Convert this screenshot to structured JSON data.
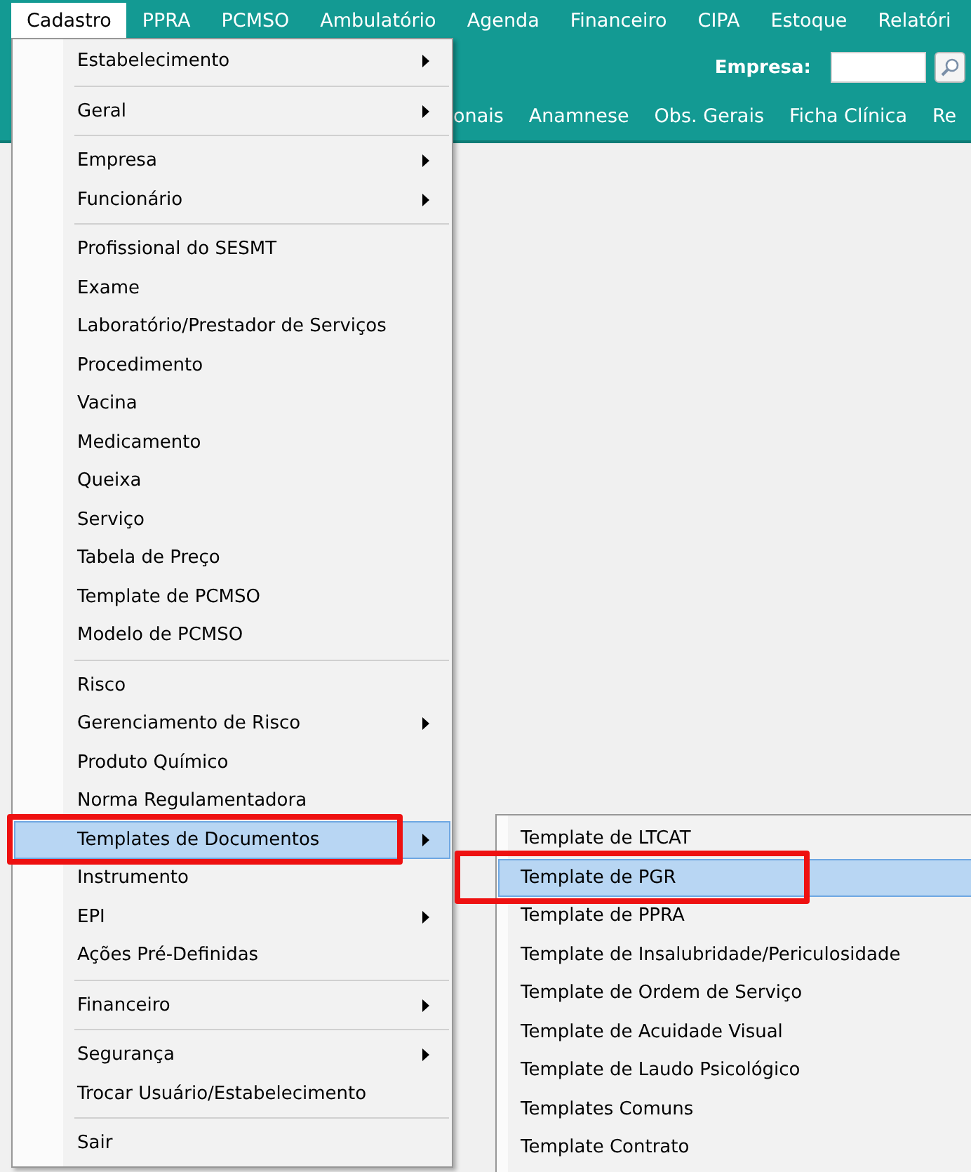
{
  "menubar": [
    {
      "label": "Cadastro",
      "selected": true
    },
    {
      "label": "PPRA",
      "selected": false
    },
    {
      "label": "PCMSO",
      "selected": false
    },
    {
      "label": "Ambulatório",
      "selected": false
    },
    {
      "label": "Agenda",
      "selected": false
    },
    {
      "label": "Financeiro",
      "selected": false
    },
    {
      "label": "CIPA",
      "selected": false
    },
    {
      "label": "Estoque",
      "selected": false
    },
    {
      "label": "Relatóri",
      "selected": false
    }
  ],
  "toolbar": {
    "company_label": "Empresa:"
  },
  "tabs": [
    "onais",
    "Anamnese",
    "Obs. Gerais",
    "Ficha Clínica",
    "Re"
  ],
  "menu": {
    "items": [
      {
        "kind": "item",
        "label": "Estabelecimento",
        "submenu": true,
        "selected": false,
        "annotated": false
      },
      {
        "kind": "separator"
      },
      {
        "kind": "item",
        "label": "Geral",
        "submenu": true,
        "selected": false,
        "annotated": false
      },
      {
        "kind": "separator"
      },
      {
        "kind": "item",
        "label": "Empresa",
        "submenu": true,
        "selected": false,
        "annotated": false
      },
      {
        "kind": "item",
        "label": "Funcionário",
        "submenu": true,
        "selected": false,
        "annotated": false
      },
      {
        "kind": "separator"
      },
      {
        "kind": "item",
        "label": "Profissional do SESMT",
        "submenu": false,
        "selected": false,
        "annotated": false
      },
      {
        "kind": "item",
        "label": "Exame",
        "submenu": false,
        "selected": false,
        "annotated": false
      },
      {
        "kind": "item",
        "label": "Laboratório/Prestador de Serviços",
        "submenu": false,
        "selected": false,
        "annotated": false
      },
      {
        "kind": "item",
        "label": "Procedimento",
        "submenu": false,
        "selected": false,
        "annotated": false
      },
      {
        "kind": "item",
        "label": "Vacina",
        "submenu": false,
        "selected": false,
        "annotated": false
      },
      {
        "kind": "item",
        "label": "Medicamento",
        "submenu": false,
        "selected": false,
        "annotated": false
      },
      {
        "kind": "item",
        "label": "Queixa",
        "submenu": false,
        "selected": false,
        "annotated": false
      },
      {
        "kind": "item",
        "label": "Serviço",
        "submenu": false,
        "selected": false,
        "annotated": false
      },
      {
        "kind": "item",
        "label": "Tabela de Preço",
        "submenu": false,
        "selected": false,
        "annotated": false
      },
      {
        "kind": "item",
        "label": "Template de PCMSO",
        "submenu": false,
        "selected": false,
        "annotated": false
      },
      {
        "kind": "item",
        "label": "Modelo de PCMSO",
        "submenu": false,
        "selected": false,
        "annotated": false
      },
      {
        "kind": "separator"
      },
      {
        "kind": "item",
        "label": "Risco",
        "submenu": false,
        "selected": false,
        "annotated": false
      },
      {
        "kind": "item",
        "label": "Gerenciamento de Risco",
        "submenu": true,
        "selected": false,
        "annotated": false
      },
      {
        "kind": "item",
        "label": "Produto Químico",
        "submenu": false,
        "selected": false,
        "annotated": false
      },
      {
        "kind": "item",
        "label": "Norma Regulamentadora",
        "submenu": false,
        "selected": false,
        "annotated": false
      },
      {
        "kind": "item",
        "label": "Templates de Documentos",
        "submenu": true,
        "selected": true,
        "annotated": true
      },
      {
        "kind": "item",
        "label": "Instrumento",
        "submenu": false,
        "selected": false,
        "annotated": false
      },
      {
        "kind": "item",
        "label": "EPI",
        "submenu": true,
        "selected": false,
        "annotated": false
      },
      {
        "kind": "item",
        "label": "Ações Pré-Definidas",
        "submenu": false,
        "selected": false,
        "annotated": false
      },
      {
        "kind": "separator"
      },
      {
        "kind": "item",
        "label": "Financeiro",
        "submenu": true,
        "selected": false,
        "annotated": false
      },
      {
        "kind": "separator"
      },
      {
        "kind": "item",
        "label": "Segurança",
        "submenu": true,
        "selected": false,
        "annotated": false
      },
      {
        "kind": "item",
        "label": "Trocar Usuário/Estabelecimento",
        "submenu": false,
        "selected": false,
        "annotated": false
      },
      {
        "kind": "separator"
      },
      {
        "kind": "item",
        "label": "Sair",
        "submenu": false,
        "selected": false,
        "annotated": false
      }
    ]
  },
  "submenu": {
    "items": [
      {
        "label": "Template de LTCAT",
        "selected": false,
        "annotated": false
      },
      {
        "label": "Template de PGR",
        "selected": true,
        "annotated": true
      },
      {
        "label": "Template de PPRA",
        "selected": false,
        "annotated": false
      },
      {
        "label": "Template de Insalubridade/Periculosidade",
        "selected": false,
        "annotated": false
      },
      {
        "label": "Template de Ordem de Serviço",
        "selected": false,
        "annotated": false
      },
      {
        "label": "Template de Acuidade Visual",
        "selected": false,
        "annotated": false
      },
      {
        "label": "Template de Laudo Psicológico",
        "selected": false,
        "annotated": false
      },
      {
        "label": "Templates Comuns",
        "selected": false,
        "annotated": false
      },
      {
        "label": "Template Contrato",
        "selected": false,
        "annotated": false
      }
    ]
  }
}
